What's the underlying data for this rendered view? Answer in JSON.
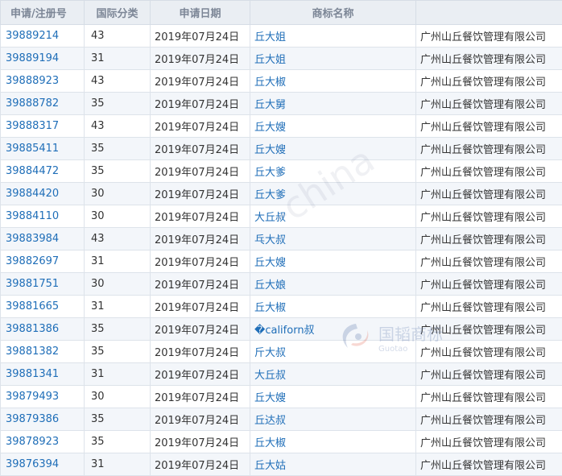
{
  "headers": [
    "申请/注册号",
    "国际分类",
    "申请日期",
    "商标名称",
    ""
  ],
  "rows": [
    {
      "reg": "39889214",
      "cls": "43",
      "date": "2019年07月24日",
      "name": "丘大姐",
      "owner": "广州山丘餐饮管理有限公司"
    },
    {
      "reg": "39889194",
      "cls": "31",
      "date": "2019年07月24日",
      "name": "丘大姐",
      "owner": "广州山丘餐饮管理有限公司"
    },
    {
      "reg": "39888923",
      "cls": "43",
      "date": "2019年07月24日",
      "name": "丘大椒",
      "owner": "广州山丘餐饮管理有限公司"
    },
    {
      "reg": "39888782",
      "cls": "35",
      "date": "2019年07月24日",
      "name": "丘大舅",
      "owner": "广州山丘餐饮管理有限公司"
    },
    {
      "reg": "39888317",
      "cls": "43",
      "date": "2019年07月24日",
      "name": "丘大嫂",
      "owner": "广州山丘餐饮管理有限公司"
    },
    {
      "reg": "39885411",
      "cls": "35",
      "date": "2019年07月24日",
      "name": "丘大嫂",
      "owner": "广州山丘餐饮管理有限公司"
    },
    {
      "reg": "39884472",
      "cls": "35",
      "date": "2019年07月24日",
      "name": "丘大爹",
      "owner": "广州山丘餐饮管理有限公司"
    },
    {
      "reg": "39884420",
      "cls": "30",
      "date": "2019年07月24日",
      "name": "丘大爹",
      "owner": "广州山丘餐饮管理有限公司"
    },
    {
      "reg": "39884110",
      "cls": "30",
      "date": "2019年07月24日",
      "name": "大丘叔",
      "owner": "广州山丘餐饮管理有限公司"
    },
    {
      "reg": "39883984",
      "cls": "43",
      "date": "2019年07月24日",
      "name": "乓大叔",
      "owner": "广州山丘餐饮管理有限公司"
    },
    {
      "reg": "39882697",
      "cls": "31",
      "date": "2019年07月24日",
      "name": "丘大嫂",
      "owner": "广州山丘餐饮管理有限公司"
    },
    {
      "reg": "39881751",
      "cls": "30",
      "date": "2019年07月24日",
      "name": "丘大娘",
      "owner": "广州山丘餐饮管理有限公司"
    },
    {
      "reg": "39881665",
      "cls": "31",
      "date": "2019年07月24日",
      "name": "丘大椒",
      "owner": "广州山丘餐饮管理有限公司"
    },
    {
      "reg": "39881386",
      "cls": "35",
      "date": "2019年07月24日",
      "name": "�californ叔",
      "owner": "广州山丘餐饮管理有限公司"
    },
    {
      "reg": "39881382",
      "cls": "35",
      "date": "2019年07月24日",
      "name": "斤大叔",
      "owner": "广州山丘餐饮管理有限公司"
    },
    {
      "reg": "39881341",
      "cls": "31",
      "date": "2019年07月24日",
      "name": "大丘叔",
      "owner": "广州山丘餐饮管理有限公司"
    },
    {
      "reg": "39879493",
      "cls": "30",
      "date": "2019年07月24日",
      "name": "丘大嫂",
      "owner": "广州山丘餐饮管理有限公司"
    },
    {
      "reg": "39879386",
      "cls": "35",
      "date": "2019年07月24日",
      "name": "丘达叔",
      "owner": "广州山丘餐饮管理有限公司"
    },
    {
      "reg": "39878923",
      "cls": "35",
      "date": "2019年07月24日",
      "name": "丘大椒",
      "owner": "广州山丘餐饮管理有限公司"
    },
    {
      "reg": "39876394",
      "cls": "31",
      "date": "2019年07月24日",
      "name": "丘大姑",
      "owner": "广州山丘餐饮管理有限公司"
    }
  ],
  "watermark": {
    "text": "-china",
    "logo_cn": "国韬商标",
    "logo_en": "Guotao"
  },
  "colors": {
    "link": "#1f6eb8",
    "header_bg": "#eaeef3",
    "header_text": "#7c8696",
    "row_alt": "#f3f6fa",
    "border": "#dde3ea"
  }
}
